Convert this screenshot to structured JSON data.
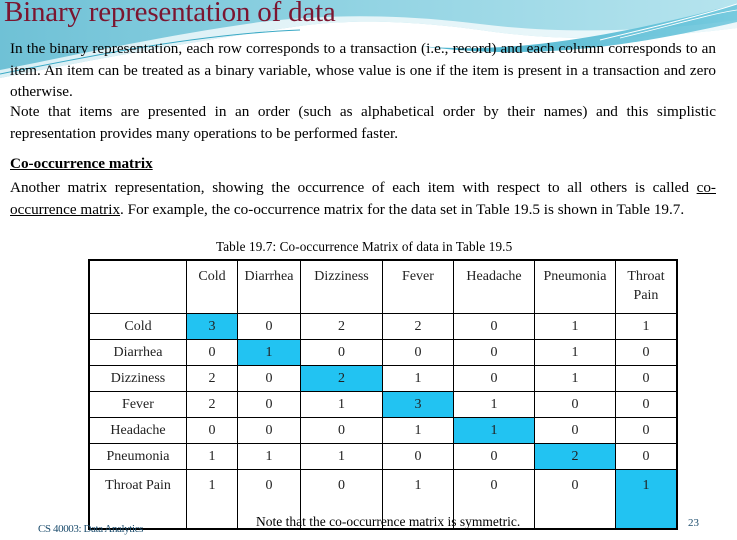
{
  "slide": {
    "title": "Binary representation of data",
    "paragraph_1": "In the binary representation, each row corresponds to a transaction (i.e., record) and each column corresponds to an item. An item can be treated as a binary variable, whose value is one if the item is present in a transaction and zero otherwise.",
    "paragraph_2": "Note that items are presented in an order (such as alphabetical order by their names) and this simplistic representation provides many operations to be performed faster.",
    "section_title": "Co-occurrence matrix",
    "paragraph_3_pre": "Another matrix representation, showing the occurrence of each item with respect to all others is called ",
    "paragraph_3_link": "co-occurrence matrix",
    "paragraph_3_post": ". For example, the co-occurrence matrix for the data set in Table 19.5 is shown in Table 19.7.",
    "table_caption": "Table 19.7: Co-occurrence Matrix of data in Table 19.5",
    "note": "Note that the co-occurrence matrix is symmetric.",
    "footer": "CS 40003: Data Analytics",
    "page_number": "23",
    "highlight_color": "#22c3f2",
    "title_color": "#7b1530"
  },
  "table": {
    "columns": [
      "Cold",
      "Diarrhea",
      "Dizziness",
      "Fever",
      "Headache",
      "Pneumonia",
      "Throat Pain"
    ],
    "rows": [
      {
        "label": "Cold",
        "values": [
          "3",
          "0",
          "2",
          "2",
          "0",
          "1",
          "1"
        ]
      },
      {
        "label": "Diarrhea",
        "values": [
          "0",
          "1",
          "0",
          "0",
          "0",
          "1",
          "0"
        ]
      },
      {
        "label": "Dizziness",
        "values": [
          "2",
          "0",
          "2",
          "1",
          "0",
          "1",
          "0"
        ]
      },
      {
        "label": "Fever",
        "values": [
          "2",
          "0",
          "1",
          "3",
          "1",
          "0",
          "0"
        ]
      },
      {
        "label": "Headache",
        "values": [
          "0",
          "0",
          "0",
          "1",
          "1",
          "0",
          "0"
        ]
      },
      {
        "label": "Pneumonia",
        "values": [
          "1",
          "1",
          "1",
          "0",
          "0",
          "2",
          "0"
        ]
      },
      {
        "label": "Throat Pain",
        "values": [
          "1",
          "0",
          "0",
          "1",
          "0",
          "0",
          "1"
        ]
      }
    ]
  }
}
